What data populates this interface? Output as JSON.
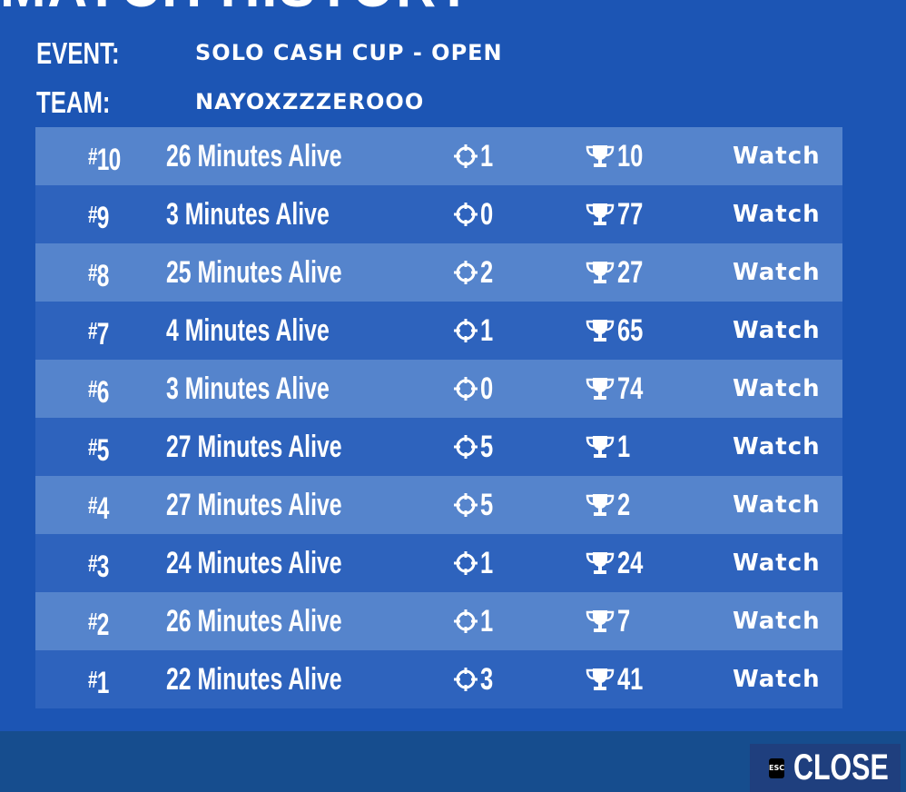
{
  "header": {
    "title": "MATCH HISTORY"
  },
  "info": {
    "event_label": "EVENT:",
    "event_value": "SOLO CASH CUP - OPEN",
    "team_label": "TEAM:",
    "team_value": "NAYOXZZZEROOO"
  },
  "matches": [
    {
      "placement": "10",
      "alive": "26 Minutes Alive",
      "elims": "1",
      "score": "10",
      "action": "Watch"
    },
    {
      "placement": "9",
      "alive": "3 Minutes Alive",
      "elims": "0",
      "score": "77",
      "action": "Watch"
    },
    {
      "placement": "8",
      "alive": "25 Minutes Alive",
      "elims": "2",
      "score": "27",
      "action": "Watch"
    },
    {
      "placement": "7",
      "alive": "4 Minutes Alive",
      "elims": "1",
      "score": "65",
      "action": "Watch"
    },
    {
      "placement": "6",
      "alive": "3 Minutes Alive",
      "elims": "0",
      "score": "74",
      "action": "Watch"
    },
    {
      "placement": "5",
      "alive": "27 Minutes Alive",
      "elims": "5",
      "score": "1",
      "action": "Watch"
    },
    {
      "placement": "4",
      "alive": "27 Minutes Alive",
      "elims": "5",
      "score": "2",
      "action": "Watch"
    },
    {
      "placement": "3",
      "alive": "24 Minutes Alive",
      "elims": "1",
      "score": "24",
      "action": "Watch"
    },
    {
      "placement": "2",
      "alive": "26 Minutes Alive",
      "elims": "1",
      "score": "7",
      "action": "Watch"
    },
    {
      "placement": "1",
      "alive": "22 Minutes Alive",
      "elims": "3",
      "score": "41",
      "action": "Watch"
    }
  ],
  "footer": {
    "esc_key": "ESC",
    "close_label": "CLOSE"
  },
  "icons": {
    "elims": "crosshair-icon",
    "score": "trophy-icon",
    "esc": "esc-key-icon"
  },
  "colors": {
    "background": "#1c55b4",
    "row_dark": "#2e63bd",
    "row_light": "#5584cc",
    "footer": "#164d8e",
    "close_button": "#1f3f7e"
  }
}
